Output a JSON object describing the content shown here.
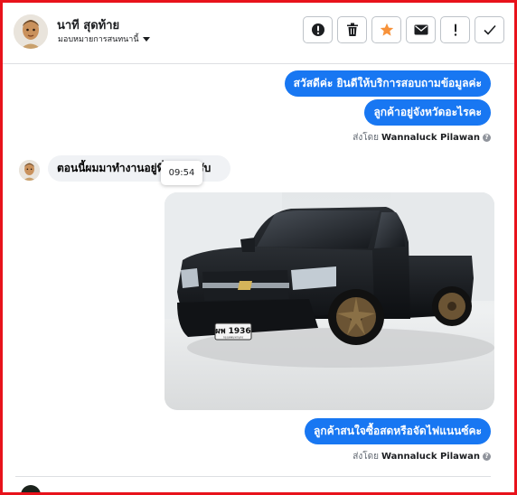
{
  "contact": {
    "name": "นาที สุดท้าย",
    "assign_label": "มอบหมายการสนทนานี้"
  },
  "toolbar": [
    {
      "name": "report-button",
      "icon": "alert-circle-icon"
    },
    {
      "name": "delete-button",
      "icon": "trash-icon"
    },
    {
      "name": "star-button",
      "icon": "star-icon"
    },
    {
      "name": "mark-unread-button",
      "icon": "envelope-icon"
    },
    {
      "name": "priority-button",
      "icon": "exclamation-icon"
    },
    {
      "name": "done-button",
      "icon": "check-icon"
    }
  ],
  "messages": {
    "out1": "สวัสดีค่ะ  ยินดีให้บริการสอบถามข้อมูลค่ะ",
    "out2": "ลูกค้าอยู่จังหวัดอะไรคะ",
    "sent_by_prefix": "ส่งโดย",
    "sent_by_name": "Wannaluck Pilawan",
    "in1": "ตอนนี้ผมมาทำงานอยู่ที่ชลบุรีครับ",
    "in1_tail": "ลบุรีครับ",
    "tooltip_time": "09:54",
    "out3": "ลูกค้าสนใจซื้อสดหรือจัดไฟแนนซ์คะ",
    "plate": "ผพ 1936",
    "plate_region": "กรุงเทพมหานคร"
  },
  "colors": {
    "accent": "#1877f2",
    "frame": "#e8121b",
    "star": "#f7923a"
  }
}
